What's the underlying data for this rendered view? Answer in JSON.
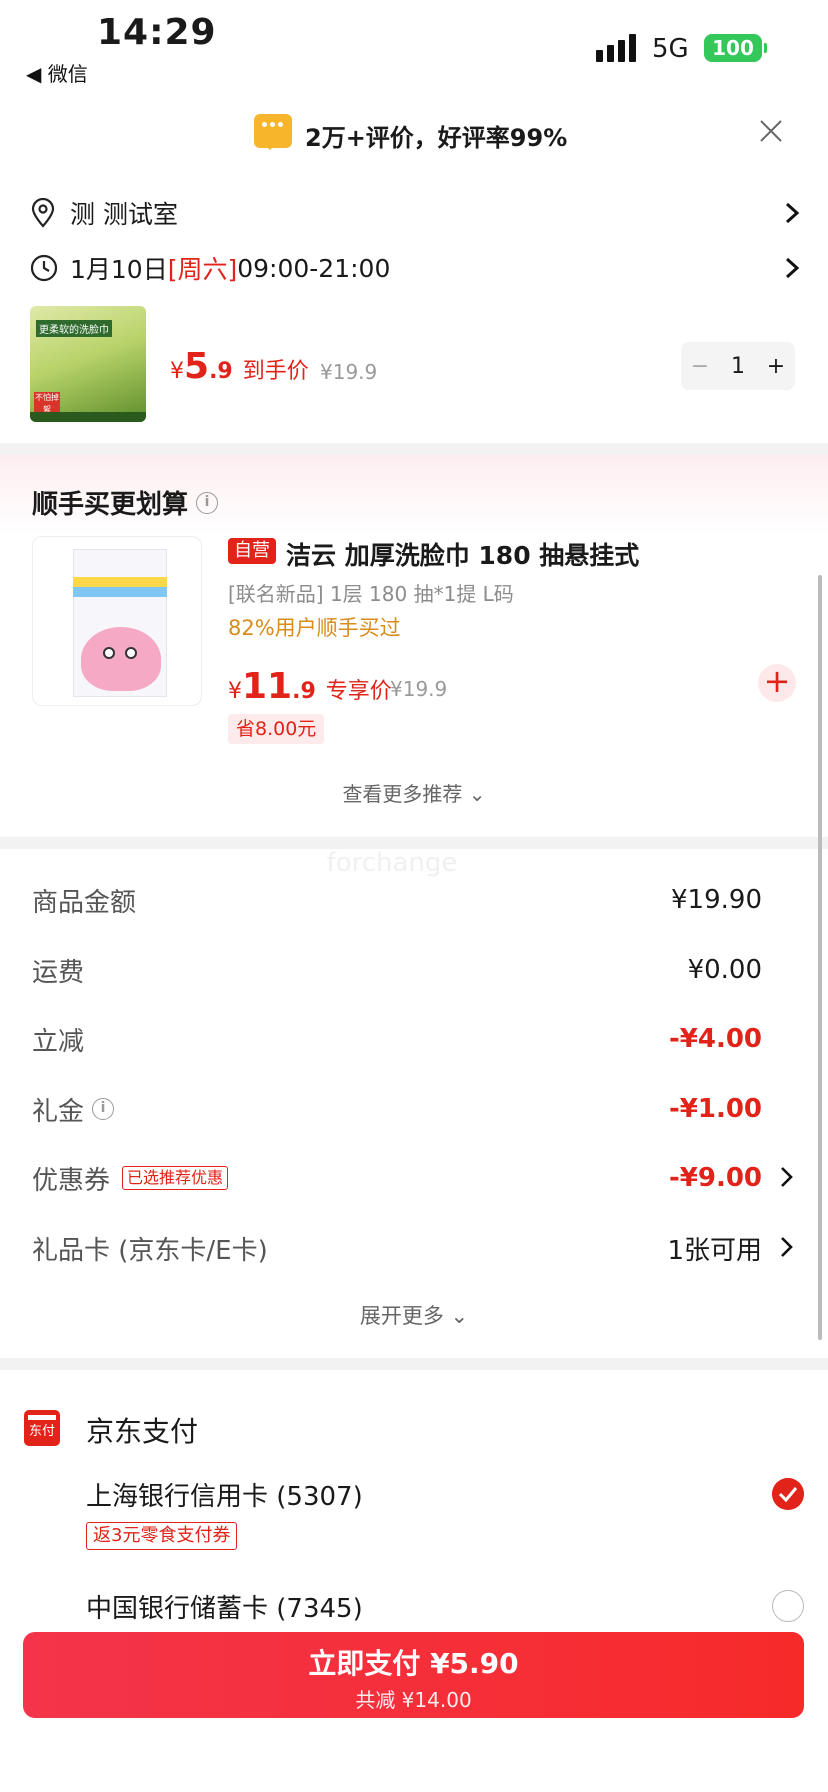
{
  "status_bar": {
    "time": "14:29",
    "back_label": "◀ 微信",
    "network": "5G",
    "battery": "100"
  },
  "banner": {
    "text": "2万+评价，好评率99%"
  },
  "address": {
    "text": "测 测试室"
  },
  "delivery": {
    "date": "1月10日 ",
    "weekday": "[周六]",
    "hours": " 09:00-21:00"
  },
  "product": {
    "currency": "¥",
    "price_int": "5",
    "price_dec": ".9",
    "price_label": "到手价",
    "original_price": "¥19.9",
    "quantity": "1",
    "thumb_title": "更柔软的洗脸巾",
    "thumb_badge": "不怕掉絮"
  },
  "recommend": {
    "title": "顺手买更划算",
    "self_tag": "自营",
    "name": "洁云 加厚洗脸巾 180 抽悬挂式",
    "sub": "[联名新品] 1层 180 抽*1提 L码",
    "buy_rate": "82%用户顺手买过",
    "currency": "¥",
    "price_int": "11",
    "price_dec": ".9",
    "price_label": "专享价",
    "original_price": "¥19.9",
    "save": "省8.00元",
    "more": "查看更多推荐 ⌄"
  },
  "watermark": "forchange",
  "fees": [
    {
      "label": "商品金额",
      "value": "¥19.90"
    },
    {
      "label": "运费",
      "value": "¥0.00"
    },
    {
      "label": "立减",
      "value": "-¥4.00"
    },
    {
      "label": "礼金",
      "value": "-¥1.00"
    },
    {
      "label": "优惠券",
      "tag": "已选推荐优惠",
      "value": "-¥9.00"
    },
    {
      "label": "礼品卡 (京东卡/E卡)",
      "value": "1张可用"
    }
  ],
  "expand_more": "展开更多 ⌄",
  "payment": {
    "logo_text": "东付",
    "title": "京东支付",
    "card1": "上海银行信用卡 (5307)",
    "card1_tag": "返3元零食支付券",
    "card2": "中国银行储蓄卡 (7345)"
  },
  "pay_button": {
    "label": "立即支付 ¥5.90",
    "sub": "共减 ¥14.00"
  },
  "colors": {
    "accent": "#e2231a",
    "battery": "#34c759",
    "coupon_gold": "#d98b1b"
  }
}
